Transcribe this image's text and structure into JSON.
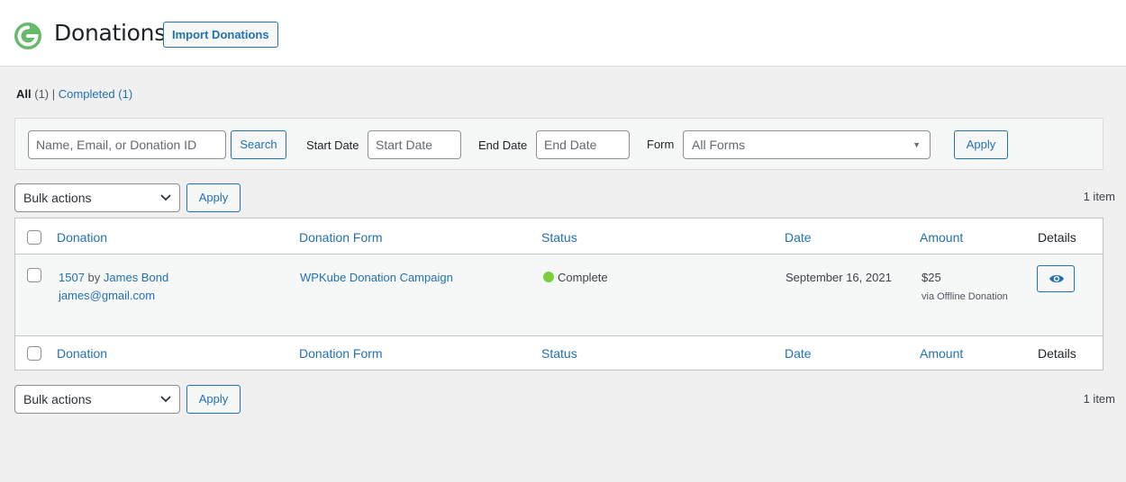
{
  "header": {
    "title": "Donations",
    "import_label": "Import Donations"
  },
  "views": {
    "all_label": "All",
    "all_count": "(1)",
    "separator": "|",
    "completed_label": "Completed",
    "completed_count": "(1)"
  },
  "filters": {
    "search_placeholder": "Name, Email, or Donation ID",
    "search_button": "Search",
    "start_date_label": "Start Date",
    "start_date_placeholder": "Start Date",
    "end_date_label": "End Date",
    "end_date_placeholder": "End Date",
    "form_label": "Form",
    "form_selected": "All Forms",
    "apply_button": "Apply"
  },
  "tablenav_top": {
    "bulk_selected": "Bulk actions",
    "apply": "Apply",
    "count": "1 item"
  },
  "tablenav_bottom": {
    "bulk_selected": "Bulk actions",
    "apply": "Apply",
    "count": "1 item"
  },
  "table": {
    "columns": [
      "Donation",
      "Donation Form",
      "Status",
      "Date",
      "Amount",
      "Details"
    ],
    "rows": [
      {
        "id": "1507",
        "by": "by",
        "donor": "James Bond",
        "email": "james@gmail.com",
        "form": "WPKube Donation Campaign",
        "status": "Complete",
        "date": "September 16, 2021",
        "amount": "$25",
        "gateway": "via Offline Donation",
        "details_icon": "eye-icon"
      }
    ]
  },
  "colors": {
    "accent": "#2271b1",
    "status_complete": "#7ad03a",
    "logo": "#66bb6a"
  }
}
